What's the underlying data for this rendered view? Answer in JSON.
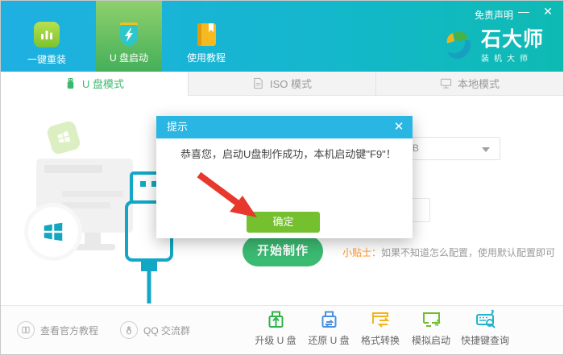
{
  "header": {
    "disclaimer": "免责声明",
    "minimize_glyph": "—",
    "close_glyph": "✕",
    "brand": {
      "name": "石大师",
      "tagline": "装机大师"
    },
    "nav": {
      "reinstall": "一键重装",
      "usb_boot": "U 盘启动",
      "tutorial": "使用教程"
    }
  },
  "tabs": {
    "usb": "U 盘模式",
    "iso": "ISO 模式",
    "local": "本地模式"
  },
  "main": {
    "device_select_value": "B",
    "start_button": "开始制作",
    "tip_label": "小贴士：",
    "tip_text": "如果不知道怎么配置，使用默认配置即可"
  },
  "dialog": {
    "title": "提示",
    "close_glyph": "✕",
    "message": "恭喜您，启动U盘制作成功，本机启动键\"F9\"！",
    "ok_button": "确定"
  },
  "footer": {
    "official_tutorial": "查看官方教程",
    "qq_group": "QQ 交流群",
    "tools": {
      "upgrade_usb": "升级 U 盘",
      "restore_usb": "还原 U 盘",
      "format_convert": "格式转换",
      "simulate_boot": "模拟启动",
      "hotkey_query": "快捷键查询"
    }
  },
  "colors": {
    "header_left": "#1fb0e2",
    "header_right": "#0ebbb3",
    "active_nav_green": "#44b059",
    "tab_active_green": "#3cb96f",
    "dialog_titlebar_blue": "#29b6e3",
    "ok_button_green": "#74c02e",
    "start_button_green": "#3bba72",
    "tip_orange": "#ff9021",
    "arrow_red": "#e8372c",
    "illustration_teal": "#14a5bf"
  }
}
